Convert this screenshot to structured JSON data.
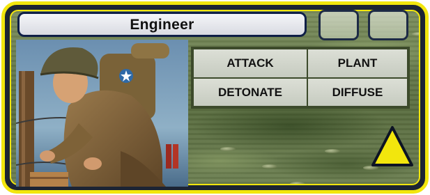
{
  "unit": {
    "name": "Engineer"
  },
  "slots": [
    {
      "name": "ability-slot-1",
      "content": ""
    },
    {
      "name": "ability-slot-2",
      "content": ""
    }
  ],
  "actions": {
    "attack": "ATTACK",
    "plant": "PLANT",
    "detonate": "DETONATE",
    "diffuse": "DIFFUSE"
  },
  "colors": {
    "frame": "#f2e60d",
    "frame_outer": "#1c2433",
    "title_border": "#0f1f47",
    "camo_base": "#64784a",
    "up_arrow": "#f2e60d"
  },
  "icons": {
    "up_button": "up-arrow-triangle-icon"
  }
}
